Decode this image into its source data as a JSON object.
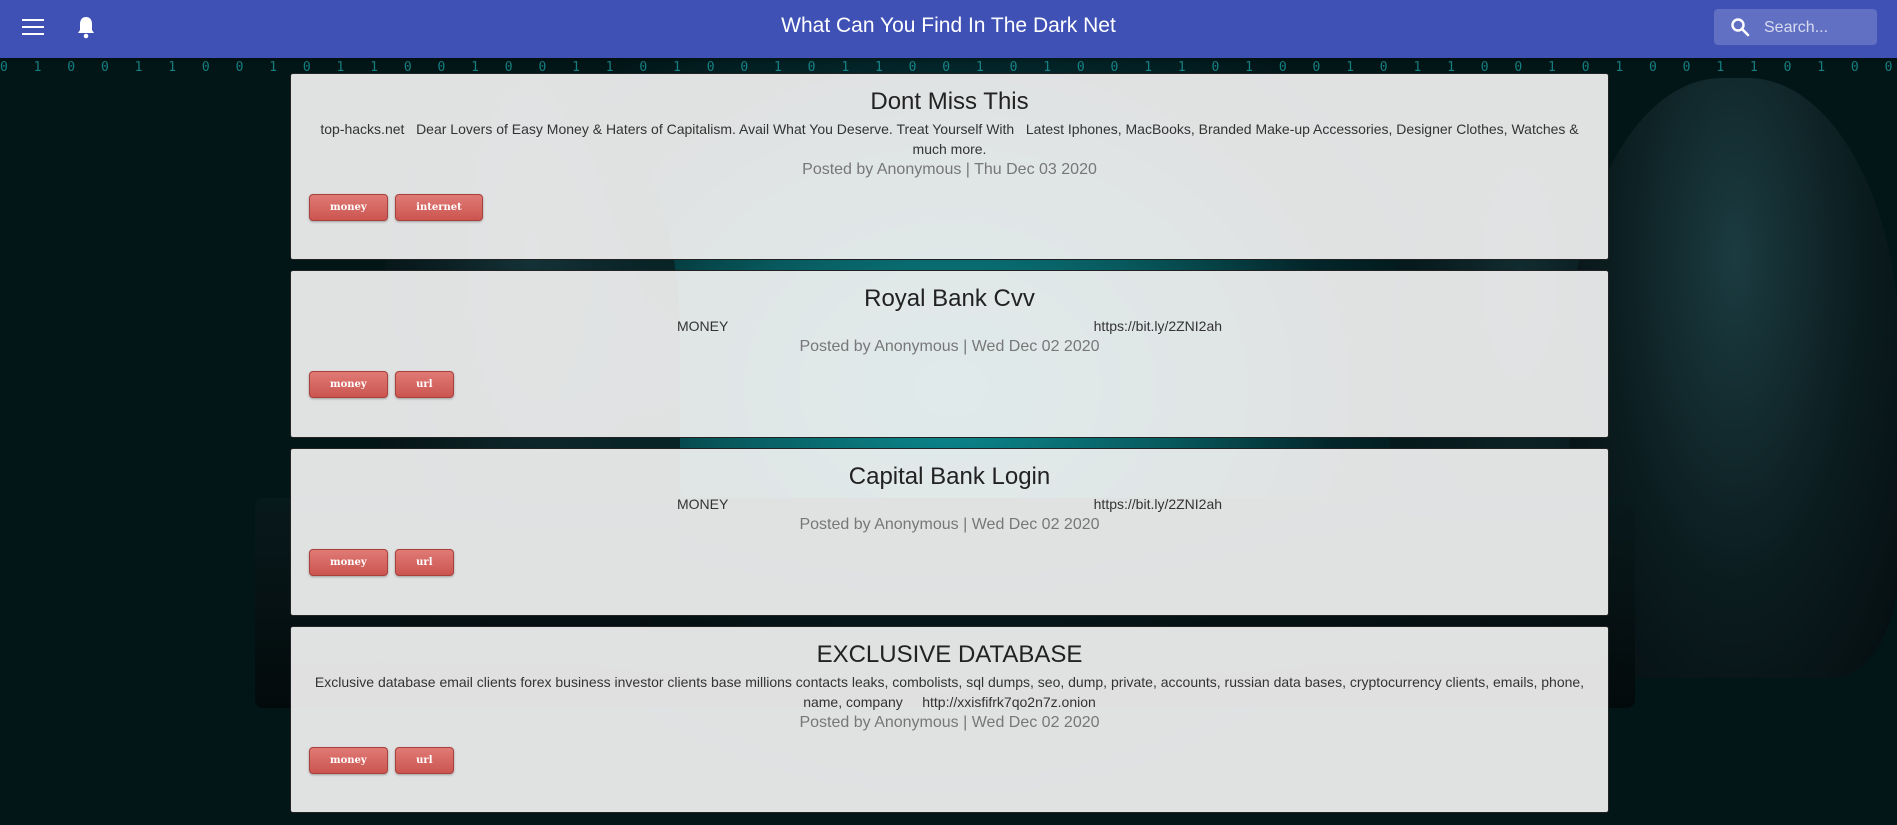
{
  "app": {
    "title": "What Can You Find In The Dark Net"
  },
  "search": {
    "placeholder": "Search..."
  },
  "icons": {
    "menu": "menu-icon",
    "notifications": "bell-icon",
    "search": "search-icon"
  },
  "colors": {
    "appbar": "#3f51b5",
    "tag": "#d9635e"
  },
  "posts": [
    {
      "title": "Dont Miss This",
      "body": "top-hacks.net   Dear Lovers of Easy Money & Haters of Capitalism. Avail What You Deserve. Treat Yourself With   Latest Iphones, MacBooks, Branded Make-up Accessories, Designer Clothes, Watches & much more.",
      "meta": "Posted by Anonymous | Thu Dec 03 2020",
      "tags": [
        "money",
        "internet"
      ]
    },
    {
      "title": "Royal Bank Cvv",
      "body": "MONEY                                                                                              https://bit.ly/2ZNI2ah",
      "meta": "Posted by Anonymous | Wed Dec 02 2020",
      "tags": [
        "money",
        "url"
      ]
    },
    {
      "title": "Capital Bank Login",
      "body": "MONEY                                                                                              https://bit.ly/2ZNI2ah",
      "meta": "Posted by Anonymous | Wed Dec 02 2020",
      "tags": [
        "money",
        "url"
      ]
    },
    {
      "title": "EXCLUSIVE DATABASE",
      "body": "Exclusive database email clients forex business investor clients base millions contacts leaks, combolists, sql dumps, seo, dump, private, accounts, russian data bases, cryptocurrency clients, emails, phone, name, company     http://xxisfifrk7qo2n7z.onion",
      "meta": "Posted by Anonymous | Wed Dec 02 2020",
      "tags": [
        "money",
        "url"
      ]
    }
  ]
}
